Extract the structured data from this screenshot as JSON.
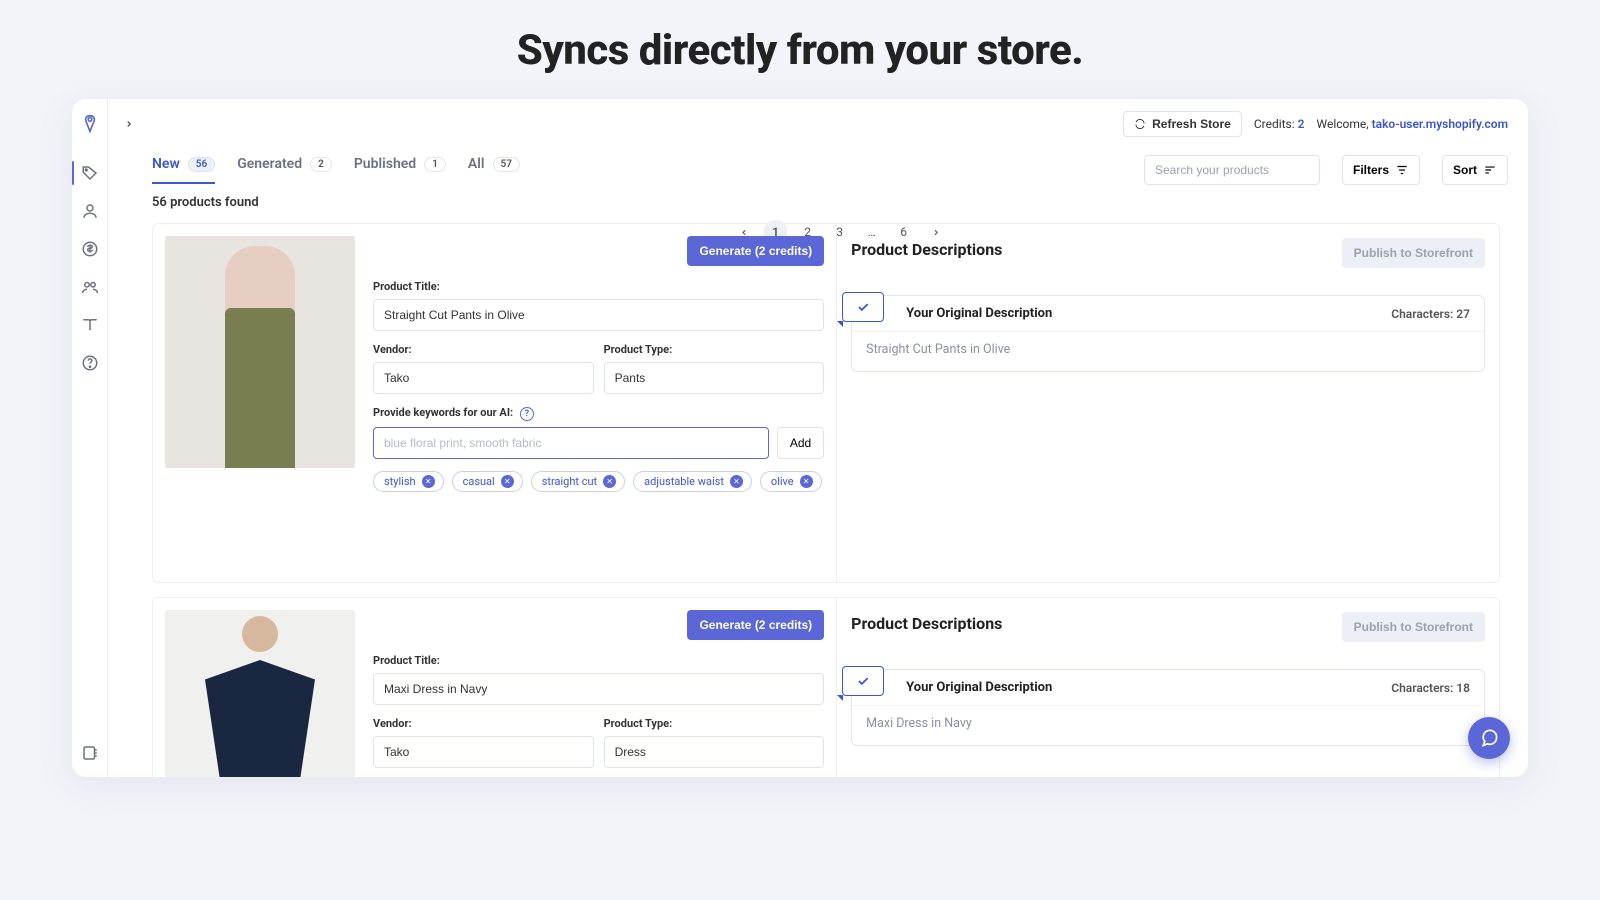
{
  "hero": "Syncs directly from your store.",
  "topbar": {
    "refresh": "Refresh Store",
    "credits_label": "Credits:",
    "credits_value": "2",
    "welcome_prefix": "Welcome, ",
    "welcome_user": "tako-user.myshopify.com"
  },
  "tabs": {
    "new": {
      "label": "New",
      "count": "56"
    },
    "generated": {
      "label": "Generated",
      "count": "2"
    },
    "published": {
      "label": "Published",
      "count": "1"
    },
    "all": {
      "label": "All",
      "count": "57"
    }
  },
  "toolbar": {
    "search_placeholder": "Search your products",
    "filters": "Filters",
    "sort": "Sort"
  },
  "results_text": "56 products found",
  "pagination": {
    "pages": [
      "1",
      "2",
      "3",
      "…",
      "6"
    ],
    "current": "1"
  },
  "labels": {
    "product_title": "Product Title:",
    "vendor": "Vendor:",
    "product_type": "Product Type:",
    "keywords": "Provide keywords for our AI:",
    "add": "Add",
    "generate": "Generate (2 credits)",
    "pd_heading": "Product Descriptions",
    "publish": "Publish to Storefront",
    "orig_desc": "Your Original Description",
    "characters": "Characters:",
    "kw_placeholder": "blue floral print, smooth fabric"
  },
  "products": [
    {
      "title": "Straight Cut Pants in Olive",
      "vendor": "Tako",
      "type": "Pants",
      "keywords": [
        "stylish",
        "casual",
        "straight cut",
        "adjustable waist",
        "olive"
      ],
      "orig_desc": "Straight Cut Pants in Olive",
      "char_count": "27"
    },
    {
      "title": "Maxi Dress in Navy",
      "vendor": "Tako",
      "type": "Dress",
      "keywords": [],
      "orig_desc": "Maxi Dress in Navy",
      "char_count": "18"
    }
  ]
}
